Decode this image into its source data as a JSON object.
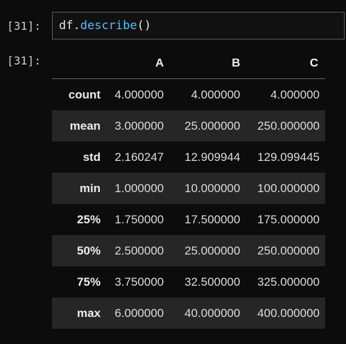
{
  "cell": {
    "input_prompt": "[31]:",
    "output_prompt": "[31]:",
    "code": {
      "object": "df",
      "dot": ".",
      "method": "describe",
      "parens": "()"
    }
  },
  "table": {
    "corner": "",
    "columns": [
      "A",
      "B",
      "C"
    ],
    "rows": [
      {
        "label": "count",
        "values": [
          "4.000000",
          "4.000000",
          "4.000000"
        ]
      },
      {
        "label": "mean",
        "values": [
          "3.000000",
          "25.000000",
          "250.000000"
        ]
      },
      {
        "label": "std",
        "values": [
          "2.160247",
          "12.909944",
          "129.099445"
        ]
      },
      {
        "label": "min",
        "values": [
          "1.000000",
          "10.000000",
          "100.000000"
        ]
      },
      {
        "label": "25%",
        "values": [
          "1.750000",
          "17.500000",
          "175.000000"
        ]
      },
      {
        "label": "50%",
        "values": [
          "2.500000",
          "25.000000",
          "250.000000"
        ]
      },
      {
        "label": "75%",
        "values": [
          "3.750000",
          "32.500000",
          "325.000000"
        ]
      },
      {
        "label": "max",
        "values": [
          "6.000000",
          "40.000000",
          "400.000000"
        ]
      }
    ]
  },
  "colors": {
    "background": "#0c0c0c",
    "stripe": "#262626",
    "method": "#4fc1ff"
  }
}
